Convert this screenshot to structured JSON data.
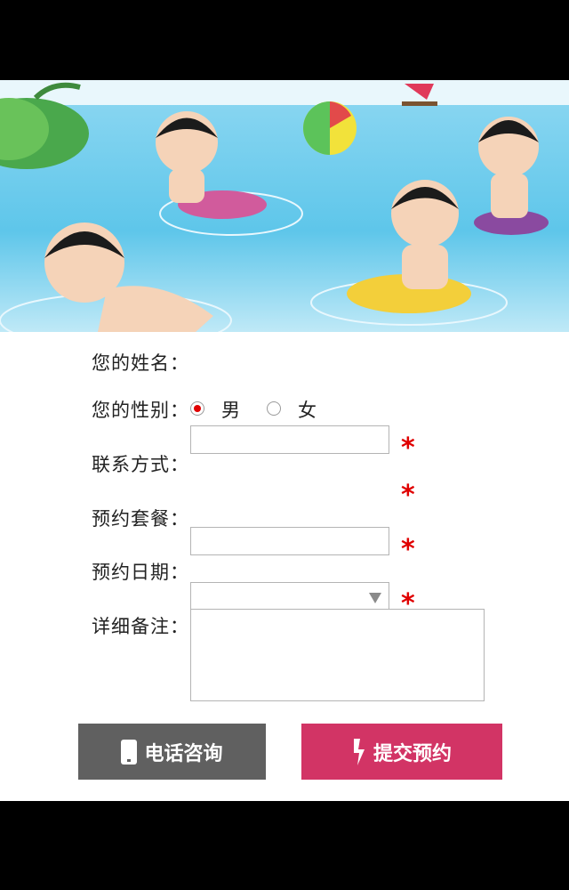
{
  "form": {
    "name_label": "您的姓名：",
    "gender_label": "您的性别：",
    "gender_options": [
      "男",
      "女"
    ],
    "gender_selected": "男",
    "contact_label": "联系方式：",
    "package_label": "预约套餐：",
    "date_label": "预约日期：",
    "notes_label": "详细备注：",
    "required_mark": "*"
  },
  "buttons": {
    "call_label": "电话咨询",
    "submit_label": "提交预约"
  },
  "colors": {
    "accent": "#d23465",
    "required": "#e00000",
    "call_button": "#606060",
    "water": "#5ec6ea"
  }
}
